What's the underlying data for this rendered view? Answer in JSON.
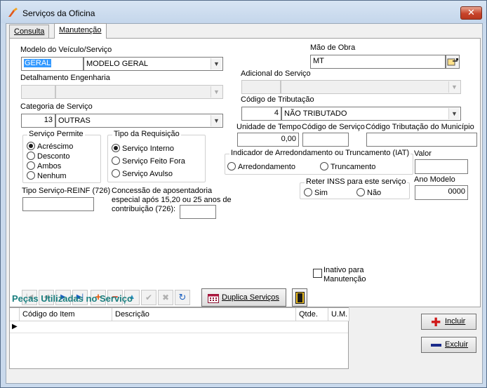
{
  "window": {
    "title": "Serviços da Oficina",
    "close_label": "✕"
  },
  "tabs": [
    {
      "label": "Consulta",
      "active": false
    },
    {
      "label": "Manutenção",
      "active": true
    }
  ],
  "form": {
    "modelo": {
      "label": "Modelo do Veículo/Serviço",
      "code": "GERAL",
      "name": "MODELO GERAL"
    },
    "detalhamento": {
      "label": "Detalhamento Engenharia",
      "code": "",
      "name": ""
    },
    "categoria": {
      "label": "Categoria de Serviço",
      "code": "13",
      "name": "OUTRAS"
    },
    "mao_de_obra": {
      "label": "Mão de Obra",
      "value": "MT"
    },
    "adicional": {
      "label": "Adicional do Serviço",
      "code": "",
      "name": ""
    },
    "tributacao": {
      "label": "Código de Tributação",
      "code": "4",
      "name": "NÃO TRIBUTADO"
    },
    "unidade_tempo": {
      "label": "Unidade de Tempo",
      "value": "0,00"
    },
    "codigo_servico": {
      "label": "Código de Serviço",
      "value": ""
    },
    "trib_municipio": {
      "label": "Código Tributação do Município",
      "value": ""
    },
    "servico_permite": {
      "label": "Serviço Permite",
      "options": [
        {
          "label": "Acréscimo",
          "checked": true
        },
        {
          "label": "Desconto",
          "checked": false
        },
        {
          "label": "Ambos",
          "checked": false
        },
        {
          "label": "Nenhum",
          "checked": false
        }
      ]
    },
    "tipo_requisicao": {
      "label": "Tipo da Requisição",
      "options": [
        {
          "label": "Serviço Interno",
          "checked": true
        },
        {
          "label": "Serviço Feito Fora",
          "checked": false
        },
        {
          "label": "Serviço Avulso",
          "checked": false
        }
      ]
    },
    "iat": {
      "label": "Indicador de Arredondamento ou Truncamento (IAT)",
      "options": [
        {
          "label": "Arredondamento",
          "checked": false
        },
        {
          "label": "Truncamento",
          "checked": false
        }
      ]
    },
    "valor": {
      "label": "Valor",
      "value": ""
    },
    "reter_inss": {
      "label": "Reter INSS para este serviço",
      "options": [
        {
          "label": "Sim",
          "checked": false
        },
        {
          "label": "Não",
          "checked": false
        }
      ]
    },
    "ano_modelo": {
      "label": "Ano Modelo",
      "value": "0000"
    },
    "tipo_reinf": {
      "label": "Tipo Serviço-REINF (726)",
      "value": ""
    },
    "aposentadoria": {
      "line1": "Concessão de aposentadoria",
      "line2": "especial após 15,20 ou 25 anos de",
      "line3": "contribuição (726):",
      "value": ""
    }
  },
  "toolbar": {
    "duplica_label": "Duplica Serviços",
    "inativo_line1": "Inativo para",
    "inativo_line2": "Manutenção",
    "inativo_checked": false
  },
  "pecas": {
    "title": "Peças Utilizadas no Serviço",
    "columns": [
      "Código do Item",
      "Descrição",
      "Qtde.",
      "U.M."
    ],
    "incluir_label": "Incluir",
    "excluir_label": "Excluir"
  },
  "colors": {
    "section_title": "#1a7f7f",
    "selection": "#3399ff",
    "incluir_icon": "#d01818",
    "excluir_icon": "#1a2a8a"
  }
}
